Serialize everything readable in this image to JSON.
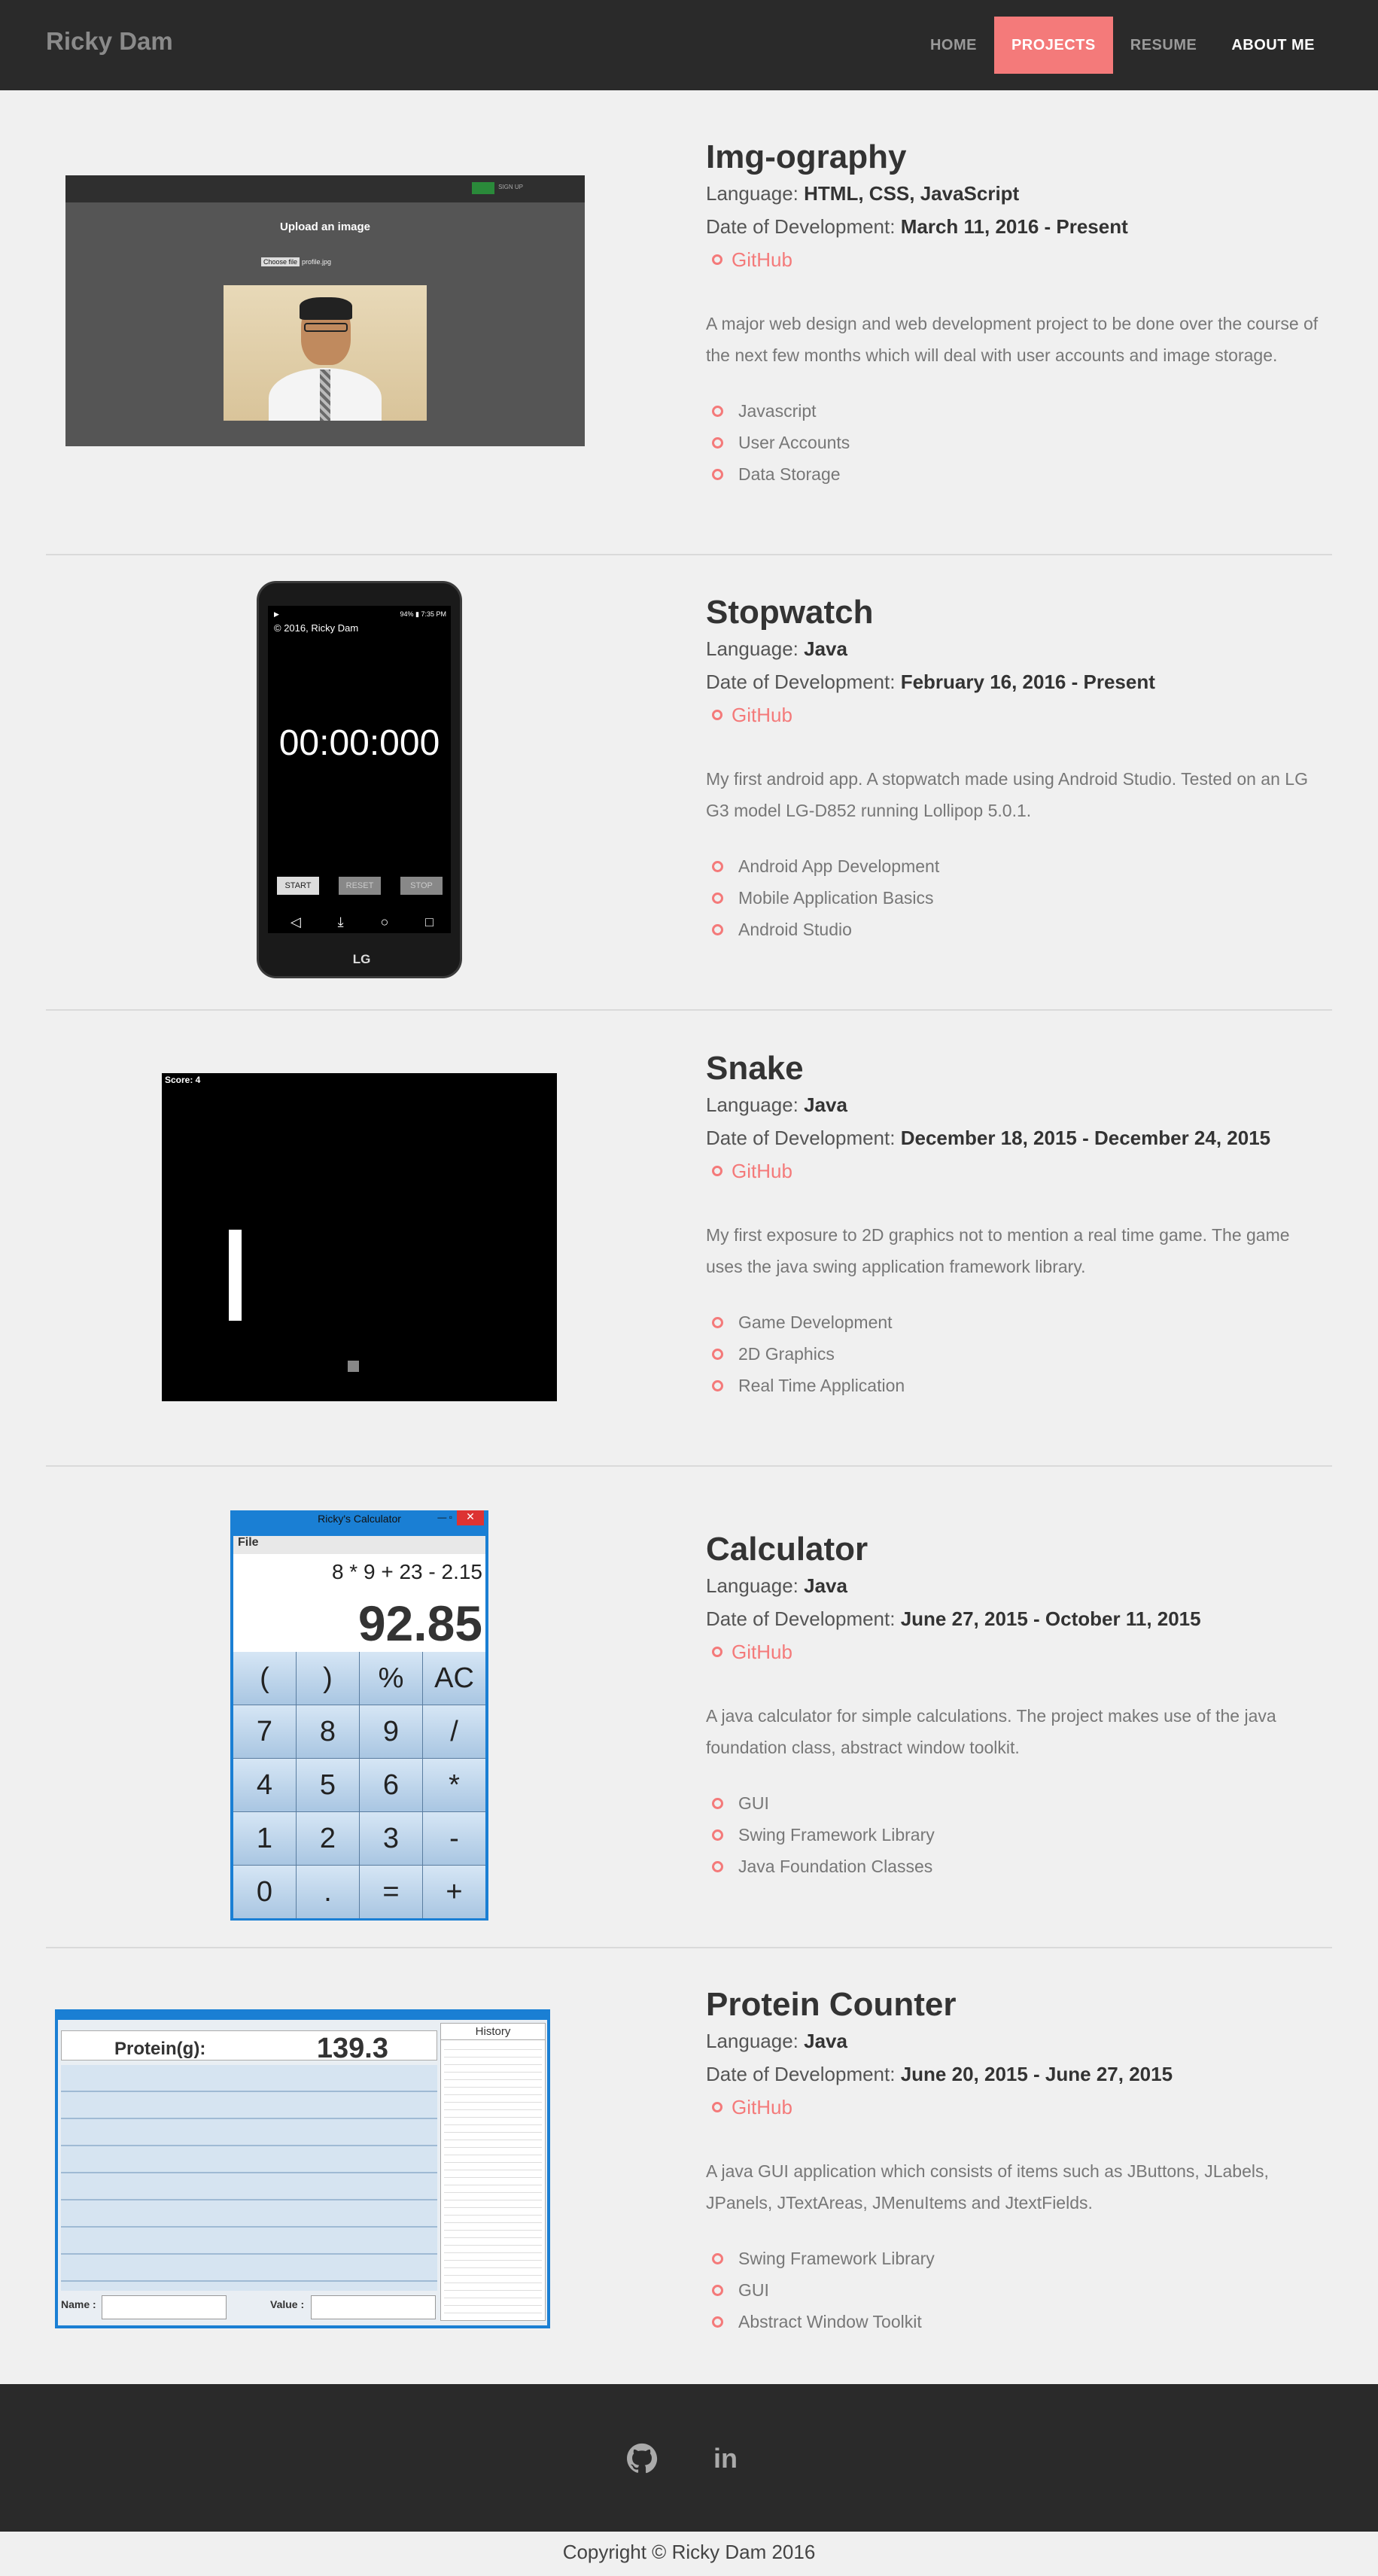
{
  "nav": {
    "brand": "Ricky Dam",
    "links": [
      "HOME",
      "PROJECTS",
      "RESUME",
      "ABOUT ME"
    ]
  },
  "labels": {
    "language": "Language:",
    "date": "Date of Development:"
  },
  "projects": [
    {
      "title": "Img-ography",
      "language": "HTML, CSS, JavaScript",
      "date": "March 11, 2016 - Present",
      "github": "GitHub",
      "description": "A major web design and web development project to be done over the course of the next few months which will deal with user accounts and image storage.",
      "features": [
        "Javascript",
        "User Accounts",
        "Data Storage"
      ]
    },
    {
      "title": "Stopwatch",
      "language": "Java",
      "date": "February 16, 2016 - Present",
      "github": "GitHub",
      "description": "My first android app. A stopwatch made using Android Studio. Tested on an LG G3 model LG-D852 running Lollipop 5.0.1.",
      "features": [
        "Android App Development",
        "Mobile Application Basics",
        "Android Studio"
      ]
    },
    {
      "title": "Snake",
      "language": "Java",
      "date": "December 18, 2015 - December 24, 2015",
      "github": "GitHub",
      "description": "My first exposure to 2D graphics not to mention a real time game. The game uses the java swing application framework library.",
      "features": [
        "Game Development",
        "2D Graphics",
        "Real Time Application"
      ]
    },
    {
      "title": "Calculator",
      "language": "Java",
      "date": "June 27, 2015 - October 11, 2015",
      "github": "GitHub",
      "description": "A java calculator for simple calculations. The project makes use of the java foundation class, abstract window toolkit.",
      "features": [
        "GUI",
        "Swing Framework Library",
        "Java Foundation Classes"
      ]
    },
    {
      "title": "Protein Counter",
      "language": "Java",
      "date": "June 20, 2015 - June 27, 2015",
      "github": "GitHub",
      "description": "A java GUI application which consists of items such as JButtons, JLabels, JPanels, JTextAreas, JMenuItems and JtextFields.",
      "features": [
        "Swing Framework Library",
        "GUI",
        "Abstract Window Toolkit"
      ]
    }
  ],
  "screens": {
    "imgography": {
      "heading": "Upload an image",
      "choose": "Choose file",
      "file": "profile.jpg"
    },
    "stopwatch": {
      "status_time": "7:35 PM",
      "status_batt": "94%",
      "copyright": "© 2016, Ricky Dam",
      "time": "00:00:000",
      "start": "START",
      "reset": "RESET",
      "stop": "STOP",
      "brand": "LG"
    },
    "snake": {
      "score": "Score: 4"
    },
    "calculator": {
      "title": "Ricky's Calculator",
      "menu": "File",
      "expression": "8 * 9 + 23 - 2.15",
      "result": "92.85",
      "keys": [
        "(",
        ")",
        "%",
        "AC",
        "7",
        "8",
        "9",
        "/",
        "4",
        "5",
        "6",
        "*",
        "1",
        "2",
        "3",
        "-",
        "0",
        ".",
        "=",
        "+"
      ]
    },
    "protein": {
      "label": "Protein(g):",
      "value": "139.3",
      "history": "History",
      "name": "Name :",
      "value_label": "Value :"
    }
  },
  "footer": {
    "copyright": "Copyright © Ricky Dam 2016",
    "icons": [
      "github-icon",
      "linkedin-icon"
    ]
  },
  "colors": {
    "accent": "#f47a7a",
    "dark": "#2a2a2a",
    "bg": "#f0f0f0"
  }
}
